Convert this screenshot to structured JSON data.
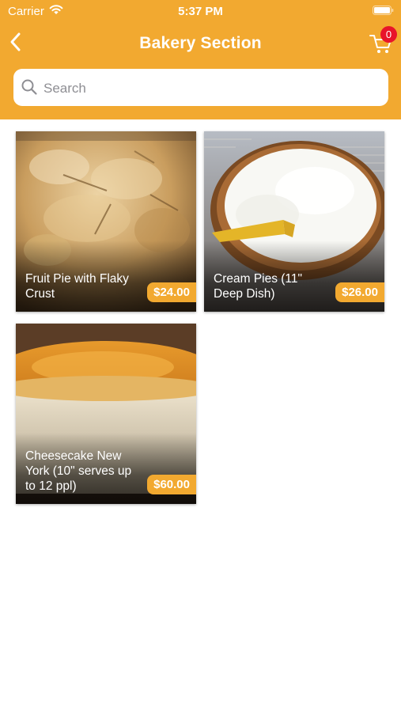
{
  "status_bar": {
    "carrier": "Carrier",
    "time": "5:37 PM"
  },
  "header": {
    "title": "Bakery Section",
    "cart_count": "0"
  },
  "search": {
    "placeholder": "Search",
    "value": ""
  },
  "colors": {
    "accent": "#F2A930",
    "badge": "#E8142A"
  },
  "icons": [
    "wifi-icon",
    "battery-icon",
    "back-chevron-icon",
    "cart-icon",
    "search-icon"
  ],
  "products": [
    {
      "name": "Fruit Pie with Flaky Crust",
      "price": "$24.00"
    },
    {
      "name": "Cream Pies (11\" Deep Dish)",
      "price": "$26.00"
    },
    {
      "name": "Cheesecake New York (10\" serves up to 12 ppl)",
      "price": "$60.00"
    }
  ]
}
